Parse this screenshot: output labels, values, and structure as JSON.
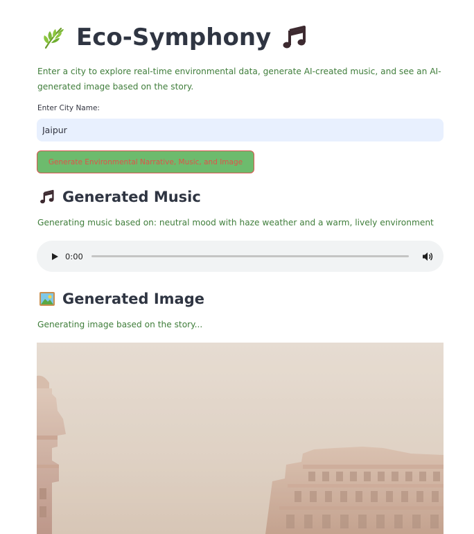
{
  "header": {
    "title": "Eco-Symphony",
    "left_icon": "herb-icon",
    "right_icon": "musical-notes-icon"
  },
  "intro": {
    "text": "Enter a city to explore real-time environmental data, generate AI-created music, and see an AI-generated image based on the story."
  },
  "city_input": {
    "label": "Enter City Name:",
    "value": "Jaipur"
  },
  "generate_button": {
    "label": "Generate Environmental Narrative, Music, and Image"
  },
  "music_section": {
    "heading": "Generated Music",
    "icon": "musical-notes-icon",
    "status": "Generating music based on: neutral mood with haze weather and a warm, lively environment"
  },
  "audio_player": {
    "time": "0:00",
    "progress": 0
  },
  "image_section": {
    "heading": "Generated Image",
    "icon": "framed-picture-icon",
    "status": "Generating image based on the story..."
  },
  "colors": {
    "text_green": "#3f7d3a",
    "button_bg": "#6dbb6d",
    "button_text": "#e0524a",
    "input_bg": "#e8f0fe",
    "heading": "#2f3542"
  }
}
